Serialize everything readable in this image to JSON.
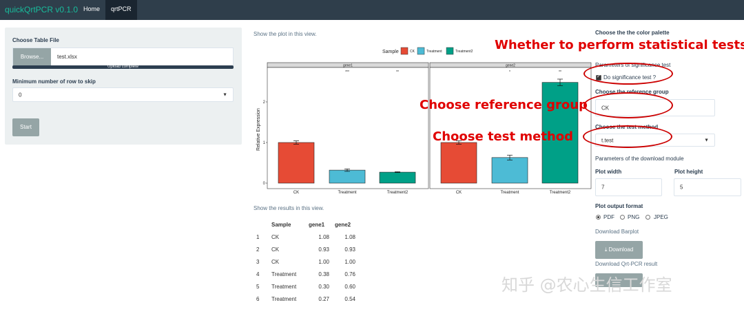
{
  "navbar": {
    "brand": "quickQrtPCR v0.1.0",
    "tabs": [
      "Home",
      "qrtPCR"
    ]
  },
  "sidebar": {
    "file_label": "Choose Table File",
    "browse_label": "Browse...",
    "file_name": "test.xlsx",
    "upload_status": "Upload complete",
    "skip_label": "Minimum number of row to skip",
    "skip_value": "0",
    "start_label": "Start"
  },
  "main": {
    "plot_link": "Show the plot in this view.",
    "results_link": "Show the results in this view."
  },
  "chart_data": {
    "type": "bar",
    "legend_title": "Sample",
    "legend_position": "top",
    "categories": [
      "CK",
      "Treatment",
      "Treatment2"
    ],
    "ylabel": "Relative Expression",
    "y_ticks": [
      "0",
      "1",
      "2"
    ],
    "ylim": [
      0,
      2.6
    ],
    "colors": {
      "CK": "#e64b35",
      "Treatment": "#4dbbd5",
      "Treatment2": "#00a087"
    },
    "panels": [
      {
        "name": "gene1",
        "values": [
          1.0,
          0.32,
          0.27
        ],
        "errors": [
          0.04,
          0.03,
          0.01
        ],
        "signif": [
          "",
          "***",
          "**"
        ]
      },
      {
        "name": "gene2",
        "values": [
          1.0,
          0.63,
          2.48
        ],
        "errors": [
          0.04,
          0.06,
          0.08
        ],
        "signif": [
          "",
          "*",
          "**"
        ]
      }
    ]
  },
  "results": {
    "headers": [
      "",
      "Sample",
      "gene1",
      "gene2"
    ],
    "rows": [
      [
        "1",
        "CK",
        "1.08",
        "1.08"
      ],
      [
        "2",
        "CK",
        "0.93",
        "0.93"
      ],
      [
        "3",
        "CK",
        "1.00",
        "1.00"
      ],
      [
        "4",
        "Treatment",
        "0.38",
        "0.76"
      ],
      [
        "5",
        "Treatment",
        "0.30",
        "0.60"
      ],
      [
        "6",
        "Treatment",
        "0.27",
        "0.54"
      ]
    ]
  },
  "right": {
    "palette_label": "Choose the the color palette",
    "signif_params_label": "Parameters of significance test",
    "do_signif_label": "Do significance test ?",
    "ref_group_label": "Choose the reference group",
    "ref_group_value": "CK",
    "test_method_label": "Choose the test method",
    "test_method_value": "t.test",
    "download_module_label": "Parameters of the download module",
    "plot_width_label": "Plot width",
    "plot_width_value": "7",
    "plot_height_label": "Plot height",
    "plot_height_value": "5",
    "output_format_label": "Plot output format",
    "formats": [
      "PDF",
      "PNG",
      "JPEG"
    ],
    "download_barplot_label": "Download Barplot",
    "download_button_label": "Download",
    "download_result_label": "Download Qrt-PCR result"
  },
  "annotations": {
    "stat_tests": "Whether to perform statistical tests.",
    "ref_group": "Choose reference group",
    "test_method": "Choose test method",
    "color": "#e00000"
  },
  "watermark": "知乎 @农心生信工作室"
}
